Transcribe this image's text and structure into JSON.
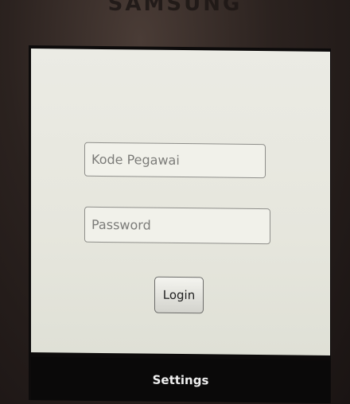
{
  "device": {
    "brand_text": "SAMSUNG"
  },
  "login_form": {
    "employee_code_placeholder": "Kode Pegawai",
    "password_placeholder": "Password",
    "login_label": "Login"
  },
  "menu": {
    "settings_label": "Settings"
  },
  "colors": {
    "app_background": "#e9e9e1",
    "field_border": "#8e8e8a",
    "menu_background": "#0a0909",
    "menu_text": "#efefef"
  }
}
